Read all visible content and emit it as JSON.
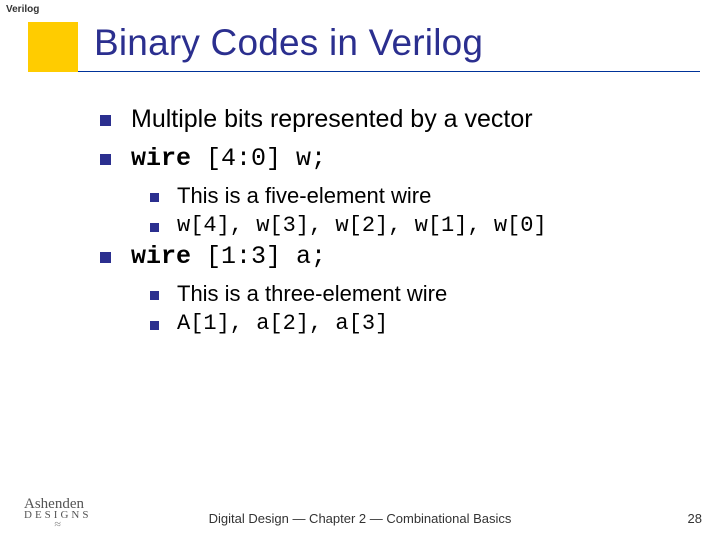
{
  "header_label": "Verilog",
  "title": "Binary Codes in Verilog",
  "bullets": {
    "b0": "Multiple bits represented by a vector",
    "b1_kw": "wire",
    "b1_rest": " [4:0] w;",
    "b1_s0": "This is a five-element wire",
    "b1_s1": "w[4], w[3], w[2], w[1], w[0]",
    "b2_kw": "wire",
    "b2_rest": " [1:3] a;",
    "b2_s0": "This is a three-element wire",
    "b2_s1": "A[1], a[2], a[3]"
  },
  "footer": "Digital Design — Chapter 2 — Combinational Basics",
  "page_number": "28",
  "logo": {
    "line1": "Ashenden",
    "line2": "DESIGNS",
    "wave": "≈"
  },
  "chart_data": null
}
